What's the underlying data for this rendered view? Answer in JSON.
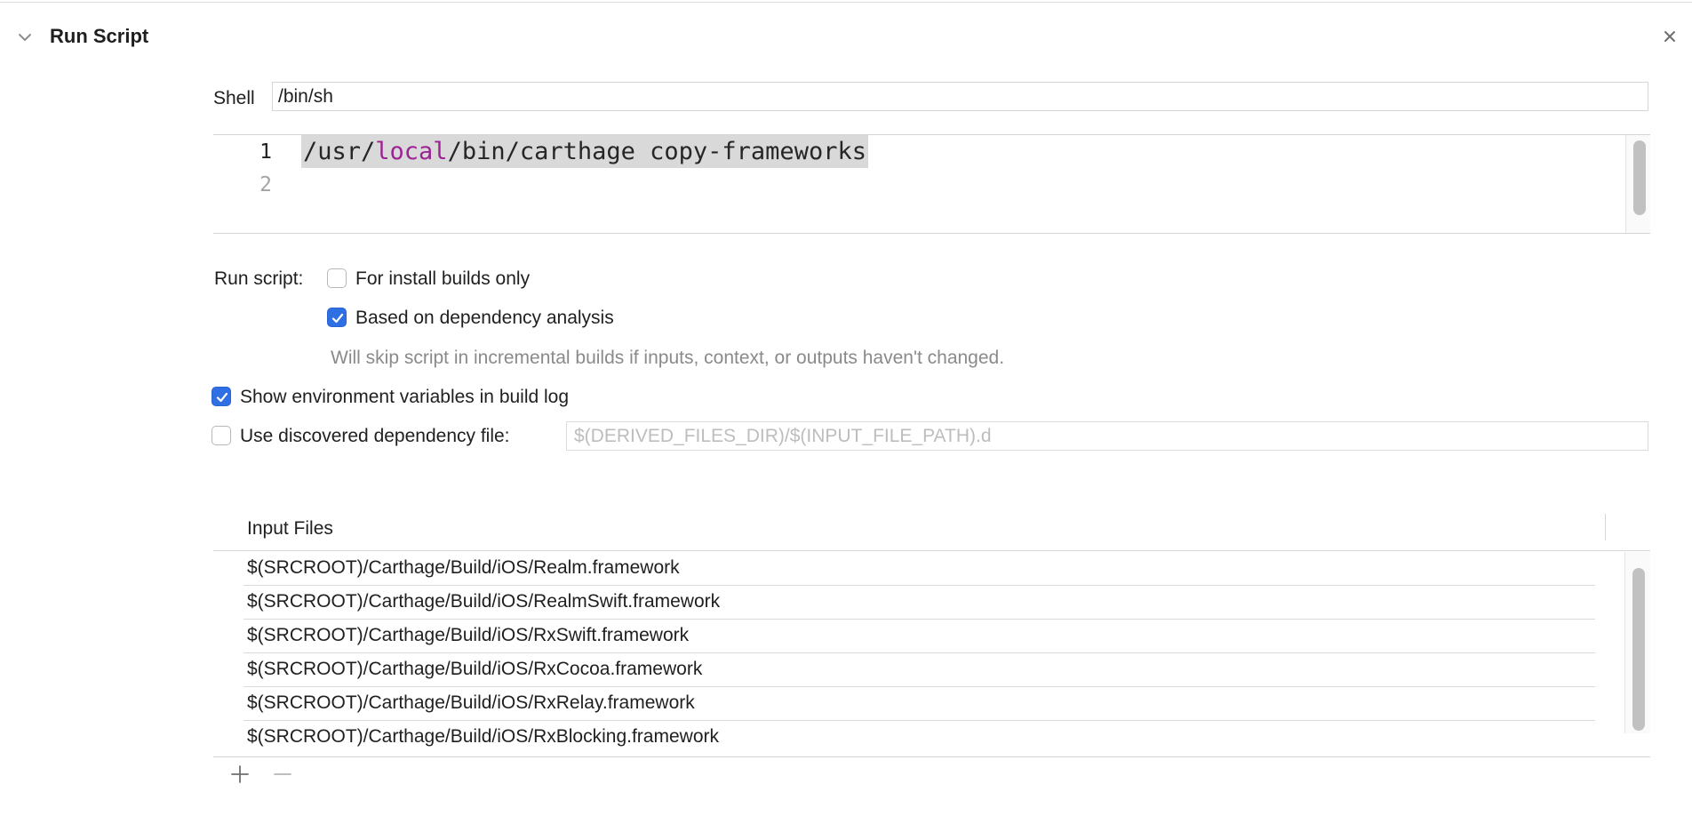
{
  "phase": {
    "title": "Run Script",
    "expanded": true
  },
  "shell": {
    "label": "Shell",
    "value": "/bin/sh"
  },
  "editor": {
    "line_numbers": [
      "1",
      "2"
    ],
    "script_line_1": {
      "prefix": "/usr/",
      "keyword": "local",
      "suffix": "/bin/carthage copy-frameworks"
    },
    "colors": {
      "keyword": "#9b2393",
      "selection": "#d9d9d9"
    }
  },
  "run_script": {
    "label": "Run script:",
    "install_builds_only": {
      "label": "For install builds only",
      "checked": false
    },
    "dependency_analysis": {
      "label": "Based on dependency analysis",
      "checked": true
    },
    "hint": "Will skip script in incremental builds if inputs, context, or outputs haven't changed."
  },
  "show_env_vars": {
    "label": "Show environment variables in build log",
    "checked": true
  },
  "discovered_dependency": {
    "label": "Use discovered dependency file:",
    "checked": false,
    "placeholder": "$(DERIVED_FILES_DIR)/$(INPUT_FILE_PATH).d",
    "value": ""
  },
  "input_files": {
    "header": "Input Files",
    "rows": [
      "$(SRCROOT)/Carthage/Build/iOS/Realm.framework",
      "$(SRCROOT)/Carthage/Build/iOS/RealmSwift.framework",
      "$(SRCROOT)/Carthage/Build/iOS/RxSwift.framework",
      "$(SRCROOT)/Carthage/Build/iOS/RxCocoa.framework",
      "$(SRCROOT)/Carthage/Build/iOS/RxRelay.framework",
      "$(SRCROOT)/Carthage/Build/iOS/RxBlocking.framework"
    ],
    "add_icon": "plus-icon",
    "remove_icon": "minus-icon"
  },
  "theme": {
    "accent": "#2f6fe4",
    "border": "#d6d6d6",
    "muted_text": "#8a8a8a"
  }
}
